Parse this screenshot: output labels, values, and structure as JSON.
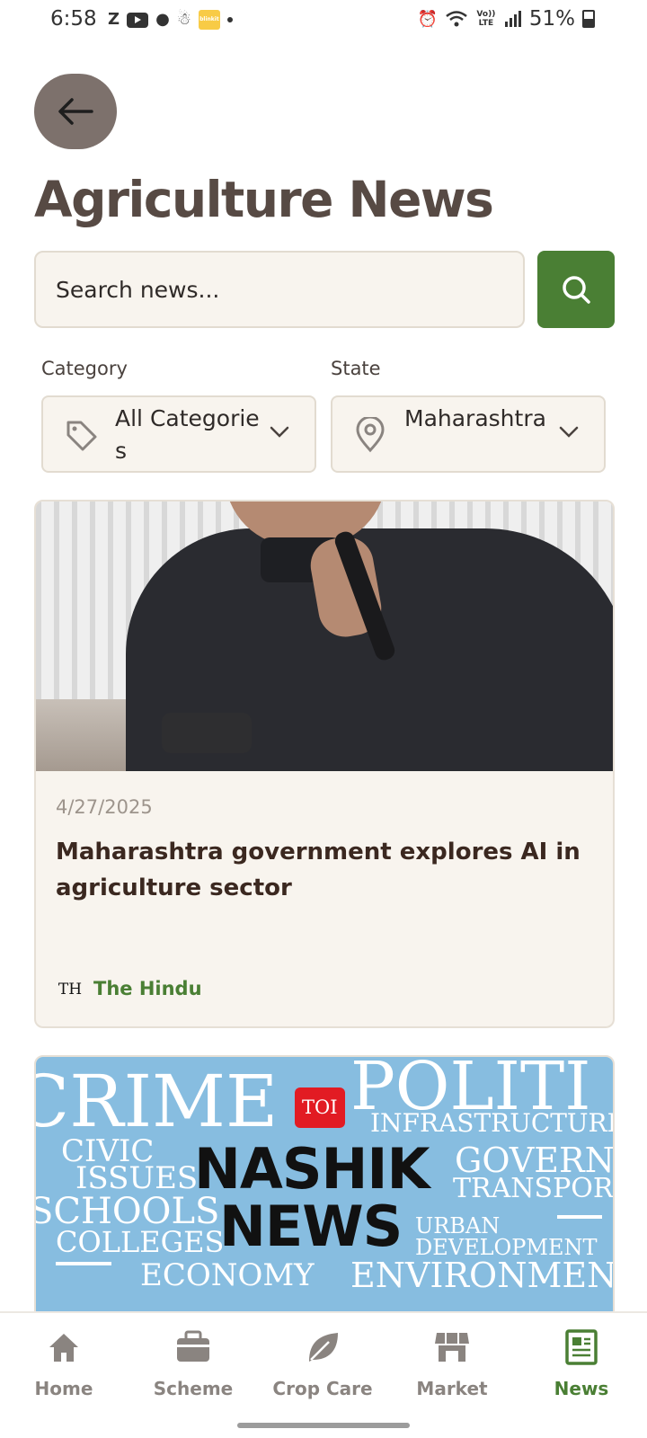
{
  "status_bar": {
    "time": "6:58",
    "left_icons": [
      "z-icon",
      "youtube-icon",
      "chat-icon",
      "notification-icon",
      "blinkit-icon",
      "dot-icon"
    ],
    "battery": "51%",
    "right_icons": [
      "alarm-icon",
      "wifi-icon",
      "volte-icon",
      "signal-icon",
      "battery-icon"
    ],
    "blinkit_text": "blinkit",
    "volte_text": "Vo)) LTE"
  },
  "header": {
    "title": "Agriculture News"
  },
  "search": {
    "placeholder": "Search news..."
  },
  "filters": {
    "category_label": "Category",
    "category_value": "All Categories",
    "state_label": "State",
    "state_value": "Maharashtra"
  },
  "news": [
    {
      "date": "4/27/2025",
      "title": "Maharashtra government explores AI in agriculture sector",
      "source_logo": "TH",
      "source": "The Hindu"
    },
    {
      "image_text": {
        "crime": "CRIME",
        "politics": "POLITI",
        "infrastructure": "INFRASTRUCTURE",
        "civic": "CIVIC",
        "issues": "ISSUES",
        "government": "GOVERN",
        "transport": "TRANSPOR",
        "schools": "SCHOOLS",
        "colleges": "COLLEGES",
        "urban": "URBAN",
        "development": "DEVELOPMENT",
        "economy": "ECONOMY",
        "environment": "ENVIRONMENT",
        "toi": "TOI",
        "nashik": "NASHIK",
        "news": "NEWS"
      }
    }
  ],
  "bottom_nav": [
    {
      "label": "Home",
      "icon": "home-icon"
    },
    {
      "label": "Scheme",
      "icon": "briefcase-icon"
    },
    {
      "label": "Crop Care",
      "icon": "leaf-icon"
    },
    {
      "label": "Market",
      "icon": "store-icon"
    },
    {
      "label": "News",
      "icon": "newspaper-icon",
      "active": true
    }
  ],
  "colors": {
    "accent": "#4a7f34",
    "title": "#574a44",
    "card_bg": "#f8f4ee"
  }
}
